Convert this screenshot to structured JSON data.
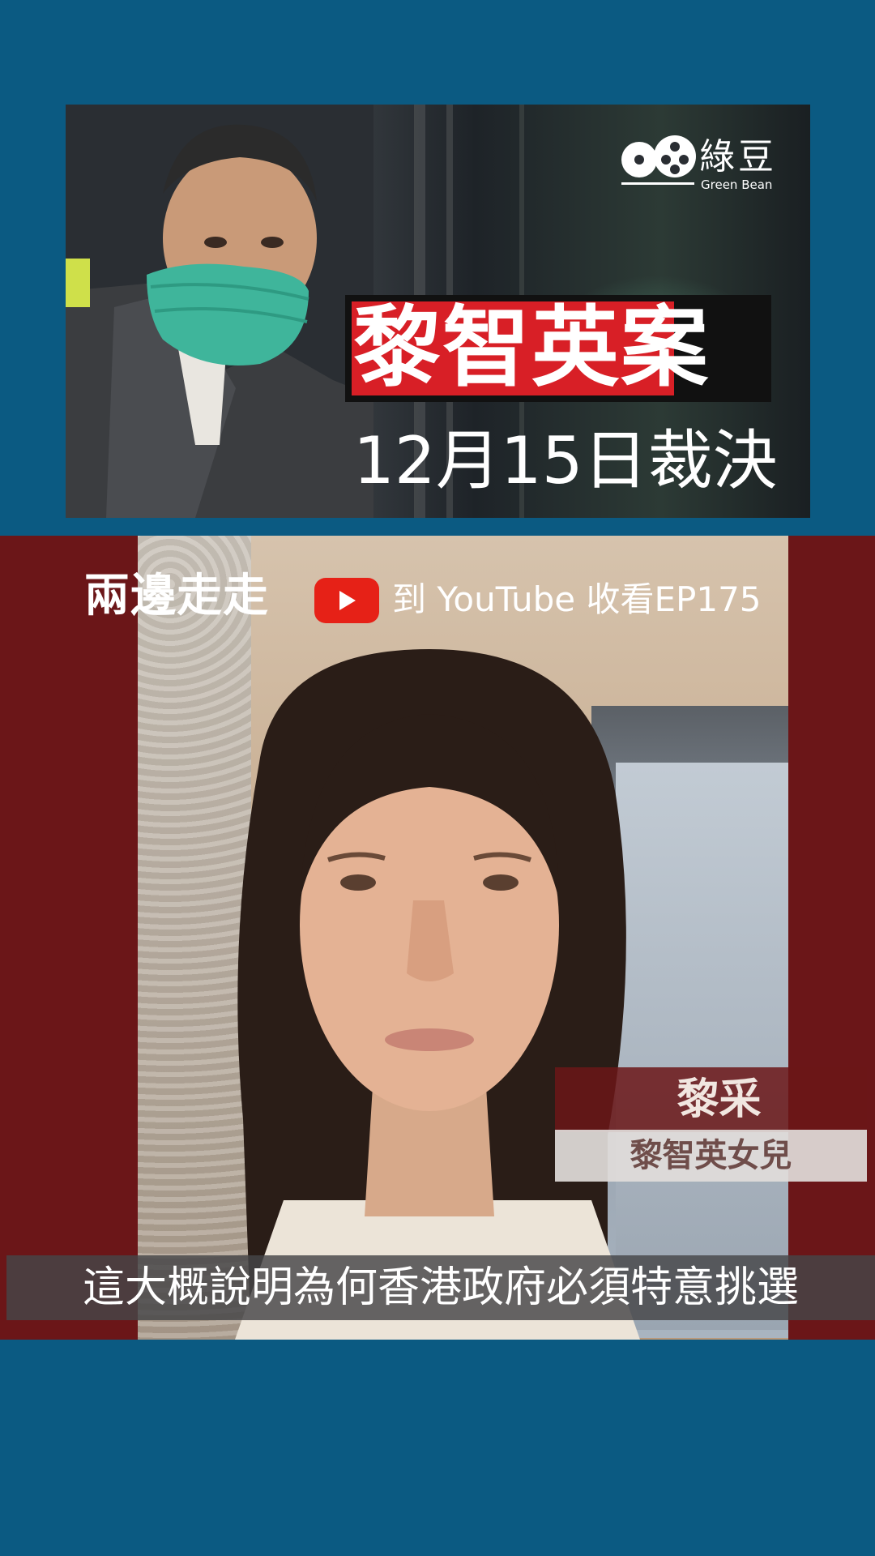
{
  "top_card": {
    "logo": {
      "chinese": "綠豆",
      "english": "Green Bean"
    },
    "headline": "黎智英案",
    "subhead": "12月15日裁決"
  },
  "video": {
    "show_logo": "兩邊走走",
    "youtube_cta": "到 YouTube 收看EP175",
    "name_tag": {
      "name": "黎采",
      "role": "黎智英女兒"
    },
    "subtitle": "這大概說明為何香港政府必須特意挑選"
  },
  "colors": {
    "background": "#0b5a82",
    "panel": "#6b1618",
    "headline_red": "#d81f26",
    "youtube_red": "#e62117"
  }
}
